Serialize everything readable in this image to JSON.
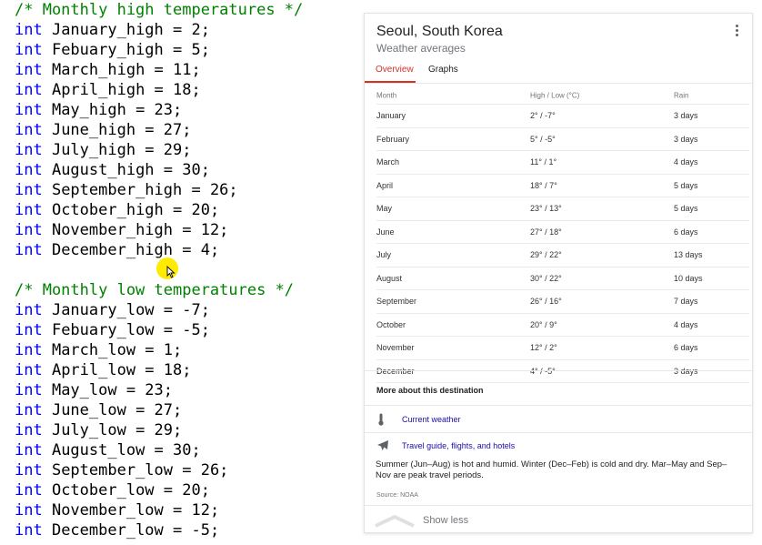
{
  "code": {
    "highs_comment": "/* Monthly high temperatures */",
    "highs": [
      "int January_high = 2;",
      "int Febuary_high = 5;",
      "int March_high = 11;",
      "int April_high = 18;",
      "int May_high = 23;",
      "int June_high = 27;",
      "int July_high = 29;",
      "int August_high = 30;",
      "int September_high = 26;",
      "int October_high = 20;",
      "int November_high = 12;",
      "int December_high = 4;"
    ],
    "lows_comment": "/* Monthly low temperatures */",
    "lows": [
      "int January_low = -7;",
      "int Febuary_low = -5;",
      "int March_low = 1;",
      "int April_low = 18;",
      "int May_low = 23;",
      "int June_low = 27;",
      "int July_low = 29;",
      "int August_low = 30;",
      "int September_low = 26;",
      "int October_low = 20;",
      "int November_low = 12;",
      "int December_low = -5;"
    ]
  },
  "card": {
    "title": "Seoul, South Korea",
    "subtitle": "Weather averages",
    "tabs": [
      {
        "label": "Overview",
        "active": true
      },
      {
        "label": "Graphs",
        "active": false
      }
    ],
    "table": {
      "headers": [
        "Month",
        "High / Low (°C)",
        "Rain"
      ],
      "rows": [
        [
          "January",
          "2° / -7°",
          "3 days"
        ],
        [
          "February",
          "5° / -5°",
          "3 days"
        ],
        [
          "March",
          "11° / 1°",
          "4 days"
        ],
        [
          "April",
          "18° / 7°",
          "5 days"
        ],
        [
          "May",
          "23° / 13°",
          "5 days"
        ],
        [
          "June",
          "27° / 18°",
          "6 days"
        ],
        [
          "July",
          "29° / 22°",
          "13 days"
        ],
        [
          "August",
          "30° / 22°",
          "10 days"
        ],
        [
          "September",
          "26° / 16°",
          "7 days"
        ],
        [
          "October",
          "20° / 9°",
          "4 days"
        ],
        [
          "November",
          "12° / 2°",
          "6 days"
        ],
        [
          "December",
          "4° / -5°",
          "3 days"
        ]
      ]
    },
    "more_heading": "More about this destination",
    "links": [
      {
        "label": "Current weather",
        "icon": "thermometer-icon"
      },
      {
        "label": "Travel guide, flights, and hotels",
        "icon": "airplane-icon"
      }
    ],
    "summary": "Summer (Jun–Aug) is hot and humid. Winter (Dec–Feb) is cold and dry. Mar–May and Sep–Nov are peak travel periods.",
    "source": "Source: NOAA",
    "show_less": "Show less"
  },
  "colors": {
    "comment": "#008000",
    "keyword": "#0000ff",
    "accent": "#d93025",
    "link": "#1a0dab",
    "highlight": "#ffeb00"
  }
}
